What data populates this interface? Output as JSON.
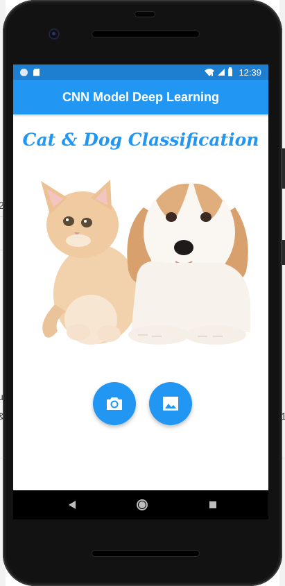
{
  "status_bar": {
    "time": "12:39",
    "icons": [
      "circle-icon",
      "sd-card-icon",
      "wifi-icon",
      "signal-icon",
      "battery-icon"
    ]
  },
  "app_bar": {
    "title": "CNN Model Deep Learning"
  },
  "main": {
    "headline": "Cat & Dog Classification",
    "hero_image": "cat-and-dog-photo"
  },
  "actions": {
    "camera_icon": "camera-icon",
    "gallery_icon": "image-gallery-icon"
  },
  "navigation": {
    "back_icon": "back-triangle-icon",
    "home_icon": "home-circle-icon",
    "recents_icon": "recents-square-icon"
  },
  "background_fragments": {
    "left_a": "2",
    "left_b": "u",
    "left_c": "&",
    "right_a": "1"
  },
  "colors": {
    "primary": "#2196f3",
    "status_bar": "#1e7fd0",
    "phone_body": "#121212",
    "nav_bar": "#000000"
  }
}
